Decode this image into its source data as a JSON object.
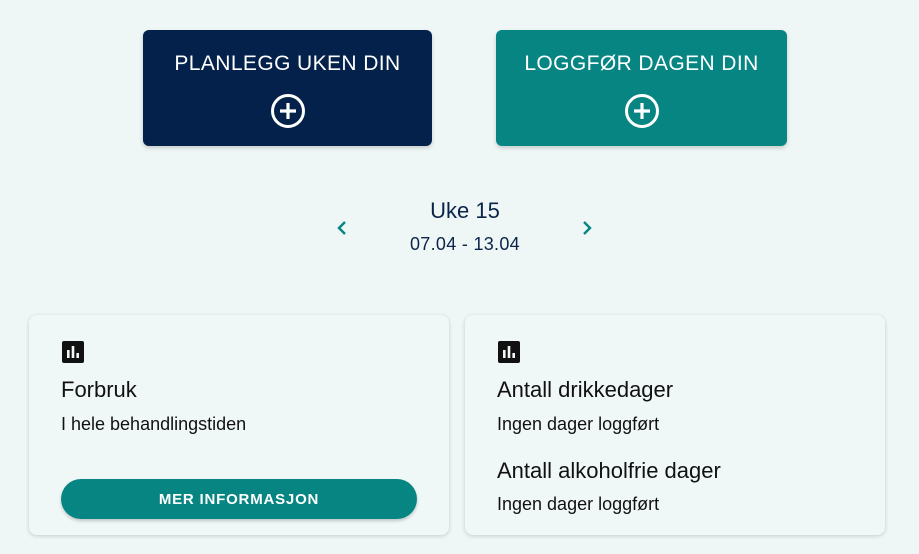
{
  "actions": {
    "plan_label": "PLANLEGG UKEN DIN",
    "log_label": "LOGGFØR DAGEN DIN"
  },
  "week": {
    "title": "Uke 15",
    "range": "07.04 - 13.04"
  },
  "cards": {
    "forbruk": {
      "title": "Forbruk",
      "subtitle": "I hele behandlingstiden",
      "button_label": "MER INFORMASJON"
    },
    "drikkedager": {
      "title": "Antall drikkedager",
      "value": "Ingen dager loggført",
      "title2": "Antall alkoholfrie dager",
      "value2": "Ingen dager loggført"
    }
  },
  "colors": {
    "navy": "#03214a",
    "teal": "#068582",
    "background": "#eff7f6"
  }
}
